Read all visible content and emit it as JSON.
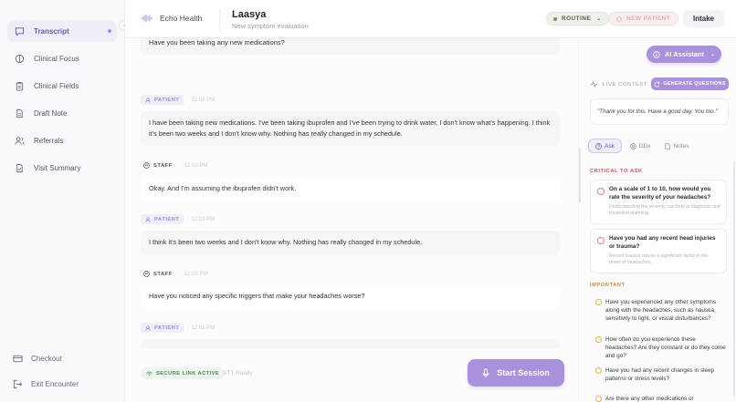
{
  "sidebar": {
    "items": [
      {
        "label": "Transcript",
        "icon": "chat-bubble-icon"
      },
      {
        "label": "Clinical Focus",
        "icon": "focus-icon"
      },
      {
        "label": "Clinical Fields",
        "icon": "clipboard-icon"
      },
      {
        "label": "Draft Note",
        "icon": "document-icon"
      },
      {
        "label": "Referrals",
        "icon": "users-icon"
      },
      {
        "label": "Visit Summary",
        "icon": "summary-icon"
      }
    ],
    "checkout": "Checkout",
    "exit": "Exit Encounter"
  },
  "header": {
    "brand": "Echo Health",
    "patient_name": "Laasya",
    "patient_subtitle": "New symptom evaluation",
    "priority": "ROUTINE",
    "new_patient": "NEW PATIENT",
    "intake": "Intake"
  },
  "transcript": {
    "cut_message": "Have you been taking any new medications?",
    "messages": [
      {
        "speaker": "PATIENT",
        "time": "12:03 PM",
        "text": "I have been taking new medications. I've been taking ibuprofen and I've been trying to drink water. I don't know what's happening. I think it's been two weeks and I don't know why. Nothing has really changed in my schedule."
      },
      {
        "speaker": "STAFF",
        "time": "12:03 PM",
        "text": "Okay. And I'm assuming the ibuprofen didn't work."
      },
      {
        "speaker": "PATIENT",
        "time": "12:03 PM",
        "text": "I think it's been two weeks and I don't know why. Nothing has really changed in my schedule."
      },
      {
        "speaker": "STAFF",
        "time": "12:03 PM",
        "text": "Have you noticed any specific triggers that make your headaches worse?"
      },
      {
        "speaker": "PATIENT",
        "time": "12:03 PM",
        "text": ""
      }
    ]
  },
  "footer": {
    "secure_link": "SECURE LINK ACTIVE",
    "stt_status": "STT Ready",
    "start_session": "Start Session"
  },
  "assistant": {
    "ai_button": "AI Assistant",
    "live_context": "LIVE CONTEXT",
    "generate": "GENERATE QUESTIONS",
    "quote": "\"Thank you for this. Have a good day. You too.\"",
    "tabs": [
      "Ask",
      "DDx",
      "Notes"
    ],
    "critical_title": "CRITICAL TO ASK",
    "critical": [
      {
        "q": "On a scale of 1 to 10, how would you rate the severity of your headaches?",
        "note": "Understanding the severity can help in diagnosis and treatment planning."
      },
      {
        "q": "Have you had any recent head injuries or trauma?",
        "note": "Recent trauma can be a significant factor in the onset of headaches."
      }
    ],
    "important_title": "IMPORTANT",
    "important": [
      "Have you experienced any other symptoms along with the headaches, such as nausea, sensitivity to light, or visual disturbances?",
      "How often do you experience these headaches? Are they constant or do they come and go?",
      "Have you had any recent changes in sleep patterns or stress levels?",
      "Are there any other medications or supplements"
    ]
  },
  "colors": {
    "accent": "#a991db",
    "accent_text": "#6b58b8",
    "critical": "#d1545e",
    "important": "#c9874a"
  }
}
